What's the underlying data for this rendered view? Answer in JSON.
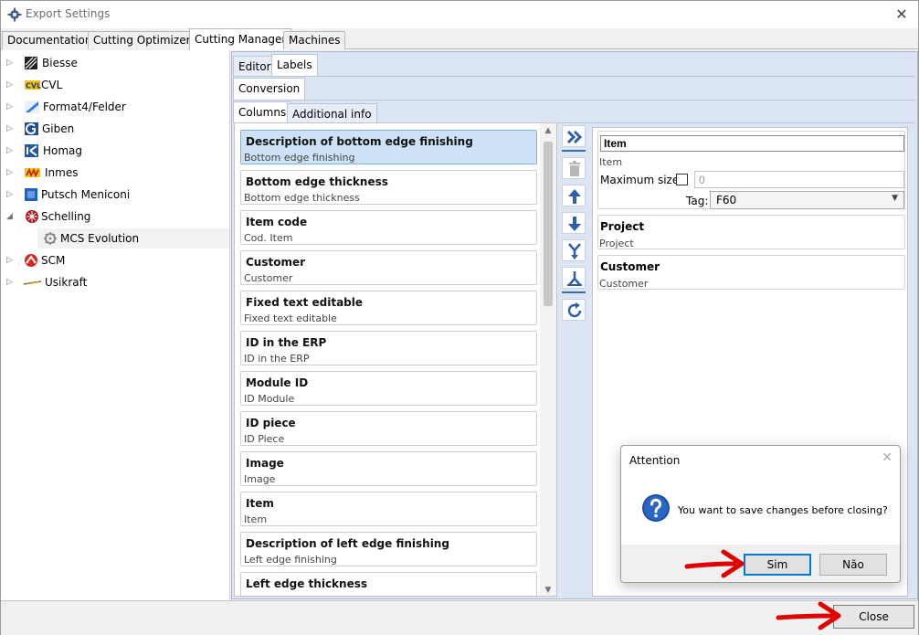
{
  "window": {
    "title": "Export Settings"
  },
  "top_tabs": [
    {
      "label": "Documentation"
    },
    {
      "label": "Cutting Optimizers"
    },
    {
      "label": "Cutting Manager"
    },
    {
      "label": "Machines"
    }
  ],
  "tree": [
    {
      "label": "Biesse",
      "expander": "▷"
    },
    {
      "label": "CVL",
      "expander": "▷"
    },
    {
      "label": "Format4/Felder",
      "expander": "▷"
    },
    {
      "label": "Giben",
      "expander": "▷"
    },
    {
      "label": "Homag",
      "expander": "▷"
    },
    {
      "label": "Inmes",
      "expander": "▷"
    },
    {
      "label": "Putsch Meniconi",
      "expander": "▷"
    },
    {
      "label": "Schelling",
      "expander": "◢"
    },
    {
      "label": "MCS Evolution",
      "expander": ""
    },
    {
      "label": "SCM",
      "expander": "▷"
    },
    {
      "label": "Usikraft",
      "expander": "▷"
    }
  ],
  "tree_icon_text": {
    "cvl": "CVL"
  },
  "editor_tabs": [
    {
      "label": "Editor"
    },
    {
      "label": "Labels"
    }
  ],
  "conversion_tabs": [
    {
      "label": "Conversion"
    }
  ],
  "column_tabs": [
    {
      "label": "Columns"
    },
    {
      "label": "Additional info"
    }
  ],
  "columns": [
    {
      "title": "Description of bottom edge finishing",
      "sub": "Bottom edge finishing"
    },
    {
      "title": "Bottom edge thickness",
      "sub": "Bottom edge thickness"
    },
    {
      "title": "Item code",
      "sub": "Cod. Item"
    },
    {
      "title": "Customer",
      "sub": "Customer"
    },
    {
      "title": "Fixed text editable",
      "sub": "Fixed text editable"
    },
    {
      "title": "ID in the ERP",
      "sub": "ID in the ERP"
    },
    {
      "title": "Module ID",
      "sub": "ID Module"
    },
    {
      "title": "ID piece",
      "sub": "ID Piece"
    },
    {
      "title": "Image",
      "sub": "Image"
    },
    {
      "title": "Item",
      "sub": "Item"
    },
    {
      "title": "Description of left edge finishing",
      "sub": "Left edge finishing"
    },
    {
      "title": "Left edge thickness",
      "sub": ""
    }
  ],
  "selected": {
    "title_value": "Item",
    "subtitle": "Item",
    "max_size_label": "Maximum size:",
    "max_size_value": "0",
    "tag_label": "Tag:",
    "tag_value": "F60"
  },
  "selected_extra": [
    {
      "title": "Project",
      "sub": "Project"
    },
    {
      "title": "Customer",
      "sub": "Customer"
    }
  ],
  "dialog": {
    "title": "Attention",
    "message": "You want to save changes before closing?",
    "yes_label": "Sim",
    "no_label": "Não"
  },
  "footer": {
    "close_label": "Close"
  },
  "colors": {
    "accent": "#0078d4",
    "arrow": "#e00000",
    "selection": "#cde2f7",
    "tool_icon": "#2f5fa8"
  }
}
